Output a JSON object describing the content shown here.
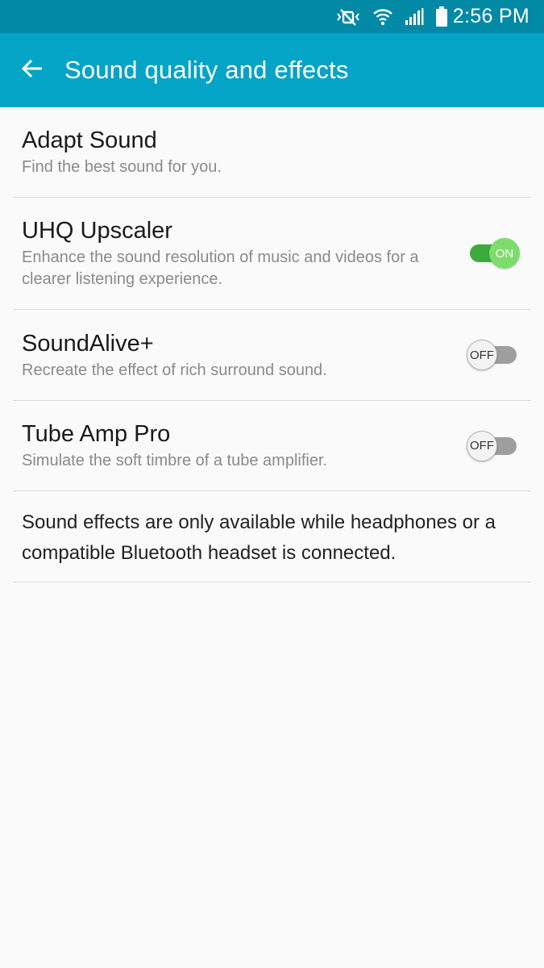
{
  "status_bar": {
    "time": "2:56 PM",
    "icons": [
      "mute-vibrate-icon",
      "wifi-icon",
      "signal-icon",
      "battery-icon"
    ]
  },
  "app_bar": {
    "title": "Sound quality and effects",
    "back_icon": "back-arrow-icon"
  },
  "settings": [
    {
      "title": "Adapt Sound",
      "subtitle": "Find the best sound for you."
    },
    {
      "title": "UHQ Upscaler",
      "subtitle": "Enhance the sound resolution of music and videos for a clearer listening experience.",
      "toggle_label": "ON",
      "enabled": true
    },
    {
      "title": "SoundAlive+",
      "subtitle": "Recreate the effect of rich surround sound.",
      "toggle_label": "OFF",
      "enabled": false
    },
    {
      "title": "Tube Amp Pro",
      "subtitle": "Simulate the soft timbre of a tube amplifier.",
      "toggle_label": "OFF",
      "enabled": false
    }
  ],
  "note": "Sound effects are only available while headphones or a compatible Bluetooth headset is connected.",
  "colors": {
    "status_bar": "#0189a6",
    "app_bar": "#03a4c6",
    "toggle_on": "#3cab3c",
    "toggle_on_thumb": "#7ddc6b",
    "toggle_off": "#9e9e9e"
  }
}
